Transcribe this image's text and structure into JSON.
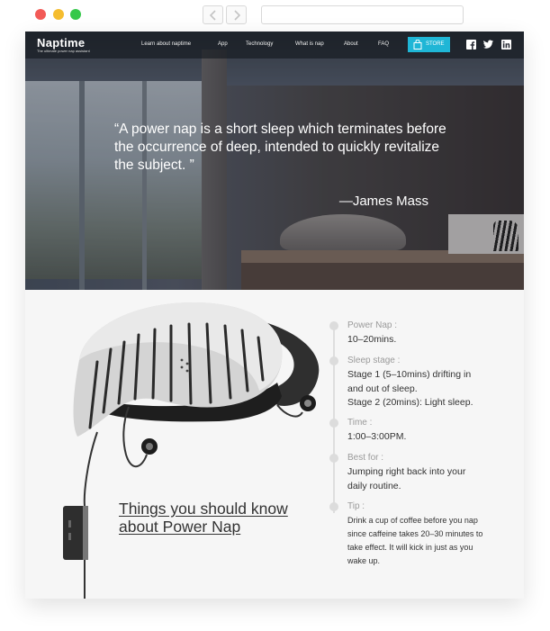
{
  "browser": {
    "window_buttons": [
      "close",
      "minimize",
      "maximize"
    ],
    "nav_icons": [
      "chevron-left-icon",
      "chevron-right-icon"
    ],
    "url": ""
  },
  "nav": {
    "logo": "Naptime",
    "tagline": "The ultimate power nap assistant",
    "links": [
      "Learn about naptime",
      "App",
      "Technology",
      "What is nap",
      "About",
      "FAQ"
    ],
    "store": "STORE",
    "social_icons": [
      "facebook-icon",
      "twitter-icon",
      "linkedin-icon"
    ],
    "accent_color": "#1fb6d6"
  },
  "hero": {
    "quote": "“A power nap is a short sleep which terminates before the occurrence of deep, intended to quickly revitalize the subject. ”",
    "author": "—James Mass"
  },
  "section": {
    "heading_line1": "Things you should know",
    "heading_line2": "about Power Nap",
    "facts": [
      {
        "label": "Power Nap :",
        "value": "10–20mins."
      },
      {
        "label": "Sleep stage :",
        "value": "Stage 1 (5–10mins) drifting in and out of sleep.",
        "value2": "Stage 2 (20mins): Light sleep."
      },
      {
        "label": "Time :",
        "value": "1:00–3:00PM."
      },
      {
        "label": "Best for :",
        "value": "Jumping right back into your daily routine."
      },
      {
        "label": "Tip :",
        "value": "Drink a cup of coffee before you nap since caffeine takes 20–30 minutes to take effect. It will kick in just as you wake up."
      }
    ]
  }
}
